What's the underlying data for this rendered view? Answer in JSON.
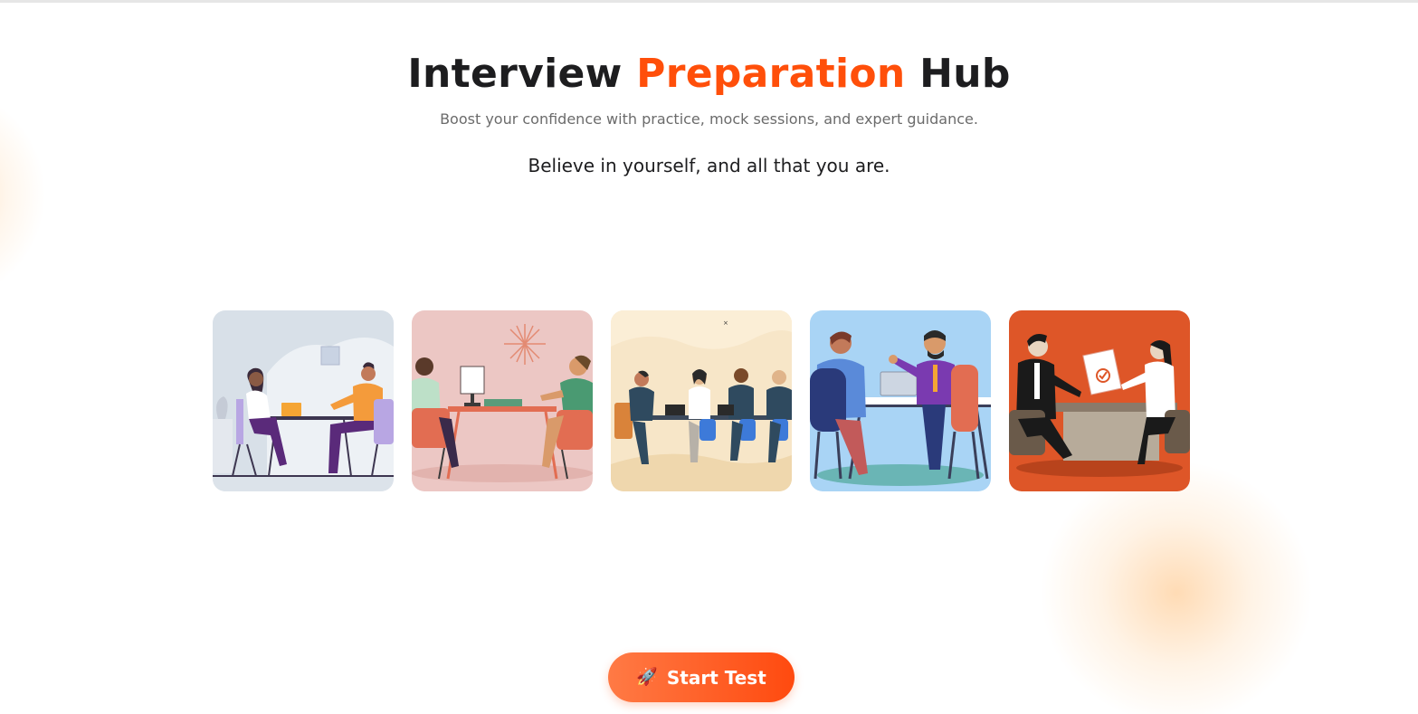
{
  "header": {
    "title_part1": "Interview",
    "title_accent": "Preparation",
    "title_part2": "Hub",
    "subtitle": "Boost your confidence with practice, mock sessions, and expert guidance.",
    "quote": "Believe in yourself, and all that you are."
  },
  "gallery": {
    "cards": [
      {
        "name": "one-on-one-interview",
        "bg": "#d8e0e8"
      },
      {
        "name": "desk-interview",
        "bg": "#ecc7c4"
      },
      {
        "name": "panel-interview",
        "bg": "#f7e6c8"
      },
      {
        "name": "friendly-discussion",
        "bg": "#a9d4f5"
      },
      {
        "name": "document-review",
        "bg": "#de5628"
      }
    ]
  },
  "actions": {
    "start_icon": "🚀",
    "start_label": "Start Test"
  },
  "colors": {
    "accent": "#ff4f0a",
    "button_start": "#ff7a45",
    "button_end": "#ff4a0f",
    "text": "#1d1d1f",
    "muted": "#6b6b6b"
  }
}
